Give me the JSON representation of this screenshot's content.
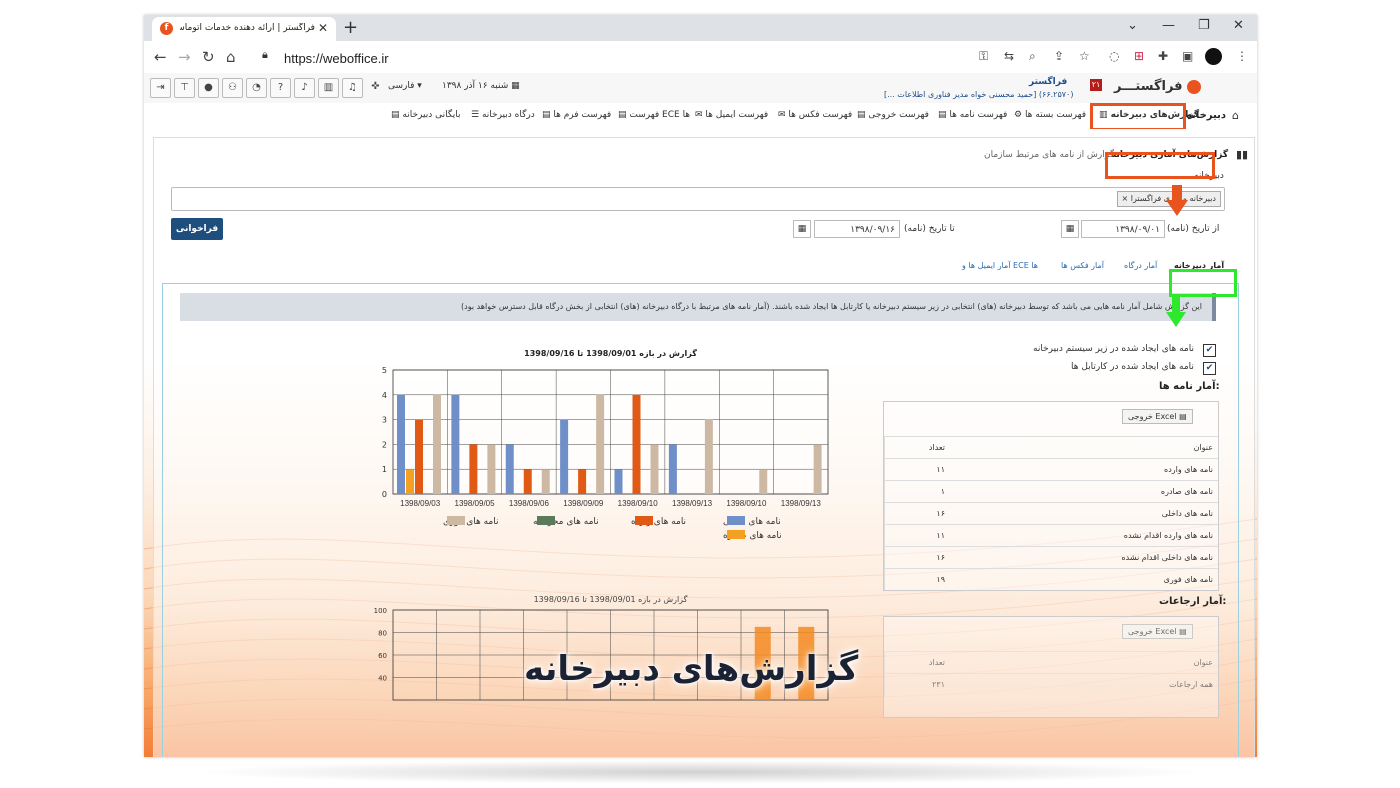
{
  "browser": {
    "tab_title": "فراگستر | ارائه دهنده خدمات اتوماسیون اد",
    "url": "https://weboffice.ir"
  },
  "header": {
    "brand": "فراگستـــر",
    "company_badge": "۲۱",
    "company_name": "فراگستر",
    "user_info": "(۶۶.۲۵۷۰) [حمید محسنی خواه مدیر فناوری اطلاعات ...]",
    "date_text": "شنبه ۱۶ آذر ۱۳۹۸",
    "language": "فارسی"
  },
  "menu": {
    "section_title": "دبیرخانه",
    "items": [
      "گزارش‌های دبیرخانه",
      "فهرست بسته ها",
      "فهرست نامه ها",
      "فهرست خروجی",
      "فهرست فکس ها",
      "فهرست ایمیل ها",
      "فهرست ECE ها",
      "فهرست فرم ها",
      "درگاه دبیرخانه",
      "بایگانی دبیرخانه"
    ]
  },
  "subtabs": {
    "active": "گزارش‌های آماری دبیرخانه",
    "other": "گزارش از نامه های مرتبط سازمان"
  },
  "filters": {
    "secretariat_label": "دبیرخانه",
    "secretariat_chip": "× دبیرخانه مرکزی فراگسترا",
    "from_label": "از تاریخ (نامه)",
    "from_value": "۱۳۹۸/۰۹/۰۱",
    "to_label": "تا تاریخ (نامه)",
    "to_value": "۱۳۹۸/۰۹/۱۶",
    "call_button": "فراخوانی"
  },
  "stat_tabs": [
    "آمار دبیرخانه",
    "آمار درگاه",
    "آمار فکس ها",
    "آمار ایمیل ها و ECE ها"
  ],
  "info_text": "این گزارش شامل آمار نامه هایی می باشد که توسط دبیرخانه (های) انتخابی در زیر سیستم دبیرخانه یا کارتابل ها ایجاد شده باشند. (آمار نامه های مرتبط با درگاه دبیرخانه (های) انتخابی از بخش درگاه قابل دسترس خواهد بود)",
  "checkboxes": [
    {
      "label": "نامه های ایجاد شده در زیر سیستم دبیرخانه",
      "checked": true
    },
    {
      "label": "نامه های ایجاد شده در کارتابل ها",
      "checked": true
    }
  ],
  "letters_stats": {
    "title": "آمار نامه ها:",
    "excel": "خروجی Excel",
    "col_name": "عنوان",
    "col_count": "تعداد",
    "rows": [
      {
        "name": "نامه های وارده",
        "count": "۱۱"
      },
      {
        "name": "نامه های صادره",
        "count": "۱"
      },
      {
        "name": "نامه های داخلی",
        "count": "۱۶"
      },
      {
        "name": "نامه های وارده اقدام نشده",
        "count": "۱۱"
      },
      {
        "name": "نامه های داخلی اقدام نشده",
        "count": "۱۶"
      },
      {
        "name": "نامه های فوری",
        "count": "۱۹"
      }
    ]
  },
  "referral_stats": {
    "title": "آمار ارجاعات:",
    "excel": "خروجی Excel",
    "col_name": "عنوان",
    "col_count": "تعداد",
    "rows": [
      {
        "name": "همه ارجاعات",
        "count": "۲۳۱"
      }
    ]
  },
  "overlay_title": "گزارش‌های دبیرخانه",
  "colors": {
    "accent_orange": "#e8531e",
    "highlight_green": "#2ee82e",
    "button_blue": "#1d4e7e",
    "bar_blue": "#6f8fc9",
    "bar_orange": "#e05a15",
    "bar_tan": "#cdb9a3",
    "bar_lightorange": "#f4a023",
    "bar_green": "#5a7a5a"
  },
  "chart_data": [
    {
      "type": "bar",
      "title": "گزارش در بازه 1398/09/01 تا 1398/09/16",
      "categories": [
        "1398/09/03",
        "1398/09/05",
        "1398/09/06",
        "1398/09/09",
        "1398/09/10",
        "1398/09/13",
        "1398/09/10",
        "1398/09/13"
      ],
      "ylim": [
        0,
        5
      ],
      "yticks": [
        0,
        1,
        2,
        3,
        4,
        5
      ],
      "series": [
        {
          "name": "نامه های داخلی",
          "color": "#6f8fc9",
          "values": [
            4,
            4,
            2,
            3,
            1,
            2,
            0,
            0
          ]
        },
        {
          "name": "نامه های وارده",
          "color": "#e05a15",
          "values": [
            3,
            2,
            1,
            1,
            4,
            0,
            0,
            0
          ]
        },
        {
          "name": "نامه های محرمانه",
          "color": "#5a7a5a",
          "values": [
            0,
            0,
            0,
            0,
            0,
            0,
            0,
            0
          ]
        },
        {
          "name": "نامه های فوری",
          "color": "#cdb9a3",
          "values": [
            4,
            2,
            1,
            4,
            2,
            3,
            1,
            2
          ]
        },
        {
          "name": "نامه های صادره",
          "color": "#f4a023",
          "values": [
            1,
            0,
            0,
            0,
            0,
            0,
            0,
            0
          ]
        }
      ],
      "legend": "bottom"
    },
    {
      "type": "bar",
      "title": "گزارش در بازه 1398/09/01 تا 1398/09/16",
      "yticks": [
        100,
        80,
        60,
        40
      ],
      "ylim": [
        40,
        100
      ],
      "values": [
        0,
        0,
        0,
        0,
        0,
        0,
        0,
        0,
        85,
        85
      ]
    }
  ]
}
